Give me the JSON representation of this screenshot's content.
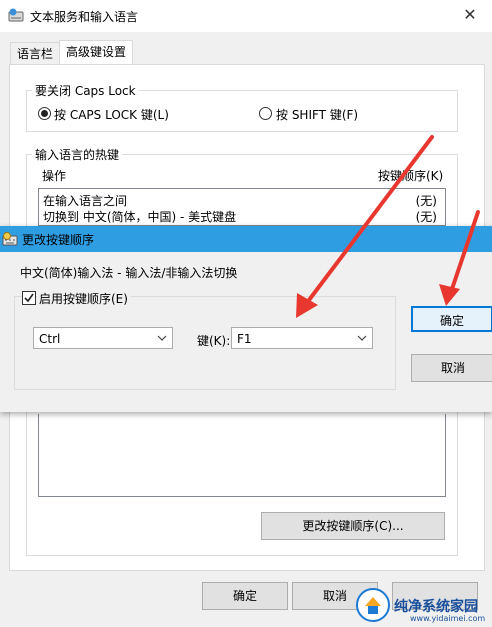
{
  "background_dialog": {
    "title": "文本服务和输入语言",
    "tabs": [
      "语言栏",
      "高级键设置"
    ],
    "caps_group": {
      "legend": "要关闭 Caps Lock",
      "option_caps": "按 CAPS LOCK 键(L)",
      "option_shift": "按 SHIFT 键(F)"
    },
    "hotkey_group": {
      "legend": "输入语言的热键",
      "col_action": "操作",
      "col_order": "按键顺序(K)",
      "rows": [
        {
          "action": "在输入语言之间",
          "order": "(无)"
        },
        {
          "action": "切换到 中文(简体，中国) - 美式键盘",
          "order": "(无)"
        }
      ],
      "change_button": "更改按键顺序(C)..."
    },
    "ok": "确定",
    "cancel": "取消",
    "apply": ""
  },
  "foreground_dialog": {
    "title": "更改按键顺序",
    "description": "中文(简体)输入法 - 输入法/非输入法切换",
    "enable_checkbox": "启用按键顺序(E)",
    "enable_checked": true,
    "modifier_value": "Ctrl",
    "key_label": "键(K):",
    "key_value": "F1",
    "ok": "确定",
    "cancel": "取消"
  },
  "watermark": {
    "text": "纯净系统家园",
    "url": "www.yidaimei.com"
  },
  "colors": {
    "titlebar_active": "#2f9de2",
    "arrow": "#e8372f",
    "default_button_border": "#0078d7"
  }
}
